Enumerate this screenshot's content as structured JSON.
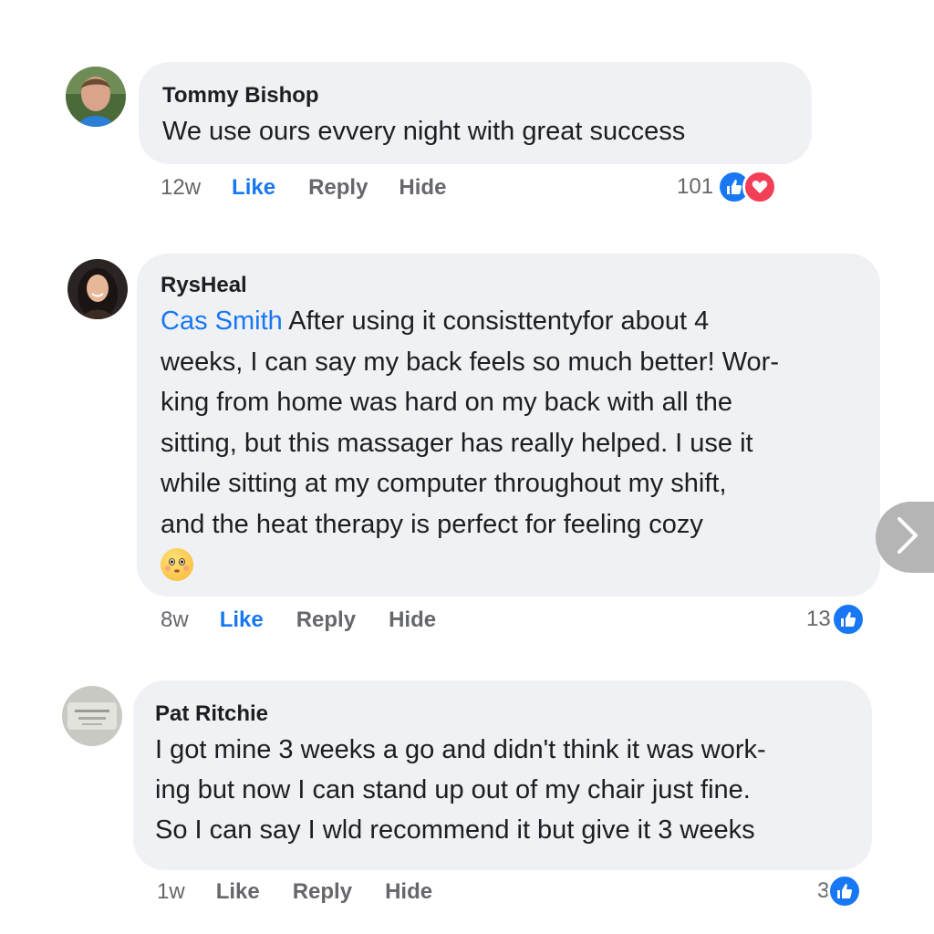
{
  "comments": [
    {
      "author": "Tommy Bishop",
      "mention": "",
      "text": "We use ours evvery night with great success",
      "time": "12w",
      "like_label": "Like",
      "reply_label": "Reply",
      "hide_label": "Hide",
      "reaction_count": "101",
      "reactions": [
        "like-icon",
        "heart-icon"
      ],
      "liked": true
    },
    {
      "author": "RysHeal",
      "mention": "Cas Smith",
      "text": "After using it consisttentyfor about 4\nweeks, I can say my back feels so much better! Wor-\nking from home was hard on my back with all the\nsitting, but this massager has really helped. I use it\nwhile sitting at my computer throughout my shift,\nand the heat therapy is perfect for feeling cozy",
      "time": "8w",
      "like_label": "Like",
      "reply_label": "Reply",
      "hide_label": "Hide",
      "reaction_count": "13",
      "reactions": [
        "like-icon"
      ],
      "liked": true,
      "emoji": "smiling-face-emoji"
    },
    {
      "author": "Pat Ritchie",
      "mention": "",
      "text": "I got mine 3 weeks a go and didn't think it was work-\ning but now I can stand up out of my chair just fine.\nSo I can say I wld recommend it but give it 3 weeks",
      "time": "1w",
      "like_label": "Like",
      "reply_label": "Reply",
      "hide_label": "Hide",
      "reaction_count": "3",
      "reactions": [
        "like-icon"
      ],
      "liked": false
    }
  ],
  "colors": {
    "bubble": "#eff1f5",
    "link_blue": "#1877f2",
    "meta_gray": "#65676b",
    "love_red": "#f33e58"
  },
  "next_button_icon": "chevron-right-icon"
}
